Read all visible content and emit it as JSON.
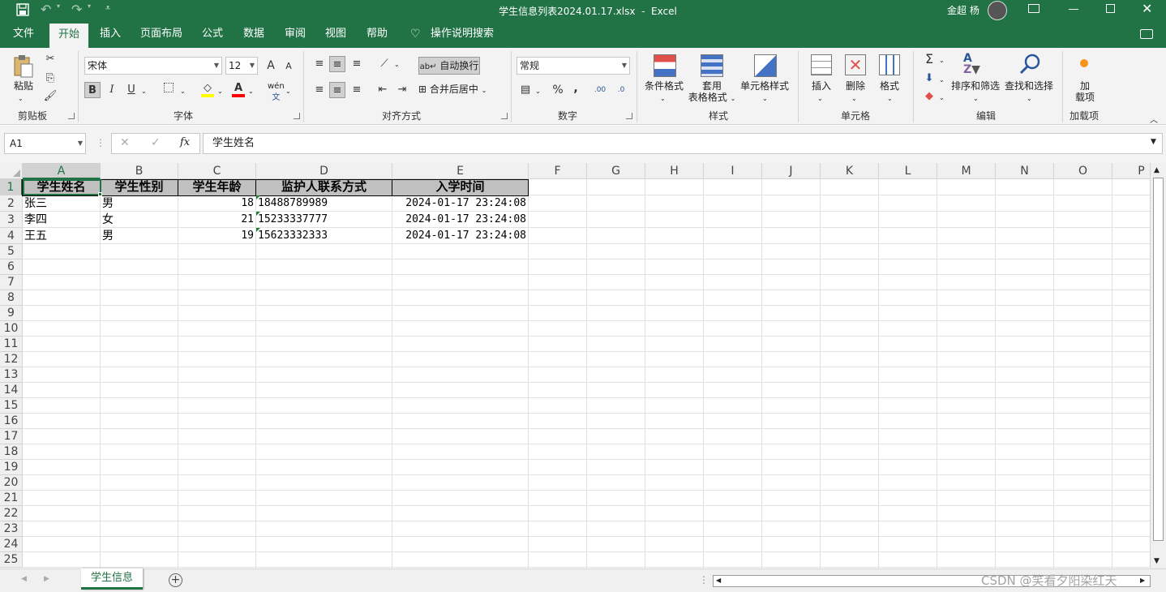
{
  "title_bar": {
    "title": "学生信息列表2024.01.17.xlsx  -  Excel",
    "user": "金超 杨",
    "save_icon": "save-icon",
    "undo_icon": "undo-icon",
    "redo_icon": "redo-icon",
    "customize_icon": "customize-qat-icon"
  },
  "ribbon_tabs": [
    "文件",
    "开始",
    "插入",
    "页面布局",
    "公式",
    "数据",
    "审阅",
    "视图",
    "帮助",
    "操作说明搜索"
  ],
  "active_tab": "开始",
  "clipboard": {
    "paste": "粘贴",
    "label": "剪贴板"
  },
  "font": {
    "name": "宋体",
    "size": "12",
    "label": "字体",
    "bold": "B",
    "italic": "I",
    "underline": "U",
    "wen": "wén",
    "wen_char": "文",
    "grow": "A",
    "shrink": "A"
  },
  "alignment": {
    "wrap": "自动换行",
    "merge": "合并后居中",
    "label": "对齐方式"
  },
  "number": {
    "format": "常规",
    "label": "数字",
    "percent": "%",
    "comma": ",",
    "inc_dec": ".00",
    "dec_dec": ".0"
  },
  "styles": {
    "conditional": "条件格式",
    "table_line1": "套用",
    "table_line2": "表格格式",
    "cell_styles": "单元格样式",
    "label": "样式"
  },
  "cells": {
    "insert": "插入",
    "delete": "删除",
    "format": "格式",
    "label": "单元格"
  },
  "editing": {
    "sort_filter": "排序和筛选",
    "find_select": "查找和选择",
    "label": "编辑",
    "sigma": "Σ"
  },
  "addins": {
    "btn_line1": "加",
    "btn_line2": "载项",
    "label": "加载项"
  },
  "formula_bar": {
    "name_box": "A1",
    "fx": "fx",
    "content": "学生姓名"
  },
  "columns": [
    "A",
    "B",
    "C",
    "D",
    "E",
    "F",
    "G",
    "H",
    "I",
    "J",
    "K",
    "L",
    "M",
    "N",
    "O",
    "P"
  ],
  "rows": [
    "1",
    "2",
    "3",
    "4",
    "5",
    "6",
    "7",
    "8",
    "9",
    "10",
    "11",
    "12",
    "13",
    "14",
    "15",
    "16",
    "17",
    "18",
    "19",
    "20",
    "21",
    "22",
    "23",
    "24",
    "25"
  ],
  "table": {
    "headers": [
      "学生姓名",
      "学生性别",
      "学生年龄",
      "监护人联系方式",
      "入学时间"
    ],
    "data": [
      [
        "张三",
        "男",
        "18",
        "18488789989",
        "2024-01-17 23:24:08"
      ],
      [
        "李四",
        "女",
        "21",
        "15233337777",
        "2024-01-17 23:24:08"
      ],
      [
        "王五",
        "男",
        "19",
        "15623332333",
        "2024-01-17 23:24:08"
      ]
    ]
  },
  "sheet_tabs": [
    "学生信息"
  ],
  "watermark": "CSDN @笑看夕阳染红天"
}
